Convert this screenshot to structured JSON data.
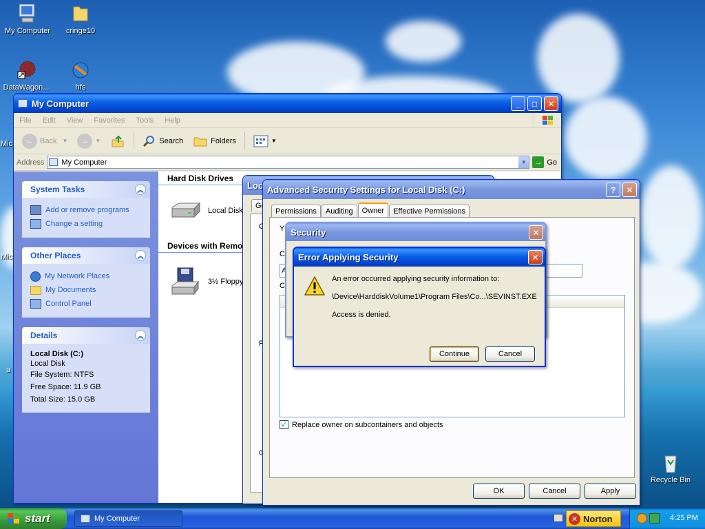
{
  "desktop": {
    "icons": [
      {
        "label": "My Computer"
      },
      {
        "label": "cringe10"
      },
      {
        "label": "DataWagon..."
      },
      {
        "label": "hfs"
      },
      {
        "label": "Recycle Bin"
      }
    ],
    "edge_fragments": [
      "Mic",
      "Mic",
      "a"
    ]
  },
  "explorer": {
    "title": "My Computer",
    "menu": [
      "File",
      "Edit",
      "View",
      "Favorites",
      "Tools",
      "Help"
    ],
    "toolbar": {
      "back": "Back",
      "search": "Search",
      "folders": "Folders"
    },
    "address": {
      "label": "Address",
      "value": "My Computer",
      "go": "Go"
    },
    "system_tasks": {
      "title": "System Tasks",
      "items": [
        "Add or remove programs",
        "Change a setting"
      ]
    },
    "other_places": {
      "title": "Other Places",
      "items": [
        "My Network Places",
        "My Documents",
        "Control Panel"
      ]
    },
    "details": {
      "title": "Details",
      "name": "Local Disk (C:)",
      "type": "Local Disk",
      "file_system": "File System: NTFS",
      "free_space": "Free Space: 11.9 GB",
      "total_size": "Total Size: 15.0 GB"
    },
    "groups": {
      "hard_disks": "Hard Disk Drives",
      "removable": "Devices with Remo",
      "local_disk": "Local Disk (",
      "floppy": "3½ Floppy"
    }
  },
  "props_window": {
    "title_fragment": "Loc",
    "tab_fragment": "Ge",
    "side_letters": [
      "G",
      "F",
      "c"
    ]
  },
  "advanced": {
    "title": "Advanced Security Settings for Local Disk (C:)",
    "help": "?",
    "tabs": [
      "Permissions",
      "Auditing",
      "Owner",
      "Effective Permissions"
    ],
    "fragments": [
      "Y",
      "C",
      "A",
      "C",
      "F",
      "c"
    ],
    "replace_owner": "Replace owner on subcontainers and objects",
    "buttons": {
      "ok": "OK",
      "cancel": "Cancel",
      "apply": "Apply"
    }
  },
  "security_dialog": {
    "title": "Security"
  },
  "error_dialog": {
    "title": "Error Applying Security",
    "line1": "An error occurred applying security information to:",
    "line2": "\\Device\\HarddiskVolume1\\Program Files\\Co...\\SEVINST.EXE",
    "line3": "Access is denied.",
    "continue": "Continue",
    "cancel": "Cancel"
  },
  "taskbar": {
    "start": "start",
    "task": "My Computer",
    "norton": "Norton",
    "clock": "4:25 PM"
  },
  "colors": {
    "xp_blue": "#0a5fe4",
    "link_blue": "#215dc6",
    "start_green": "#3c9a3c"
  }
}
